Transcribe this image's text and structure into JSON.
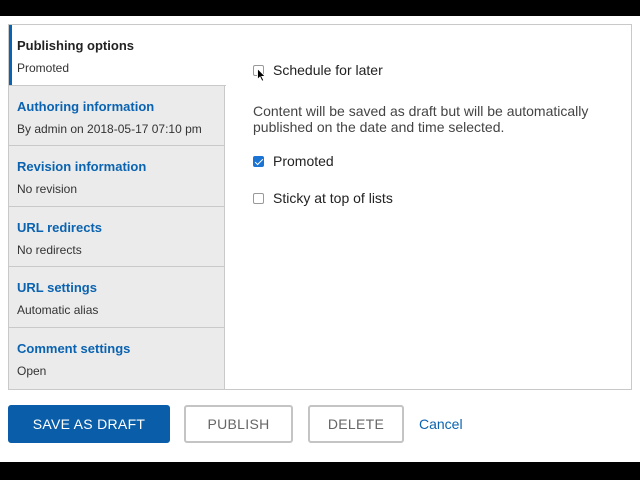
{
  "tabs": [
    {
      "title": "Publishing options",
      "summary": "Promoted",
      "active": true
    },
    {
      "title": "Authoring information",
      "summary": "By admin on 2018-05-17 07:10 pm",
      "active": false
    },
    {
      "title": "Revision information",
      "summary": "No revision",
      "active": false
    },
    {
      "title": "URL redirects",
      "summary": "No redirects",
      "active": false
    },
    {
      "title": "URL settings",
      "summary": "Automatic alias",
      "active": false
    },
    {
      "title": "Comment settings",
      "summary": "Open",
      "active": false
    }
  ],
  "options": {
    "schedule": {
      "label": "Schedule for later",
      "checked": false
    },
    "help": "Content will be saved as draft but will be automatically published on the date and time selected.",
    "promoted": {
      "label": "Promoted",
      "checked": true
    },
    "sticky": {
      "label": "Sticky at top of lists",
      "checked": false
    }
  },
  "actions": {
    "save_draft": "SAVE AS DRAFT",
    "publish": "PUBLISH",
    "delete": "DELETE",
    "cancel": "Cancel"
  },
  "colors": {
    "accent": "#0a63b0",
    "primary_button": "#0a5ea9",
    "checkbox_checked": "#1b73d3"
  }
}
